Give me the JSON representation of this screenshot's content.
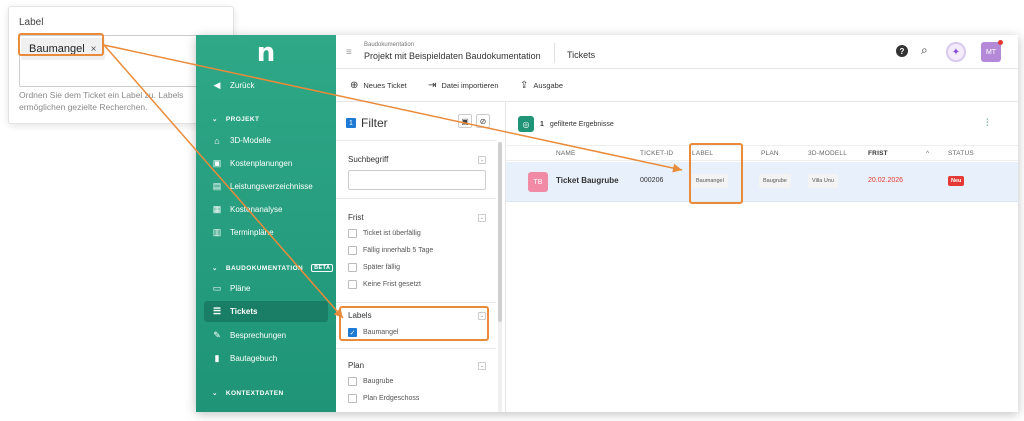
{
  "label_card": {
    "title": "Label",
    "chip_text": "Baumangel",
    "chip_remove": "×",
    "hint": "Ordnen Sie dem Ticket ein Label zu. Labels ermöglichen gezielte Recherchen."
  },
  "sidebar": {
    "logo": "n",
    "back": "Zurück",
    "sections": [
      {
        "label": "PROJEKT"
      },
      {
        "label": "BAUDOKUMENTATION",
        "badge": "BETA"
      },
      {
        "label": "KONTEXTDATEN"
      }
    ],
    "projekt_items": [
      "3D-Modelle",
      "Kostenplanungen",
      "Leistungsverzeichnisse",
      "Kostenanalyse",
      "Terminpläne"
    ],
    "baudoku_items": [
      "Pläne",
      "Tickets",
      "Besprechungen",
      "Bautagebuch"
    ],
    "active_item": "Tickets"
  },
  "topbar": {
    "crumb_small": "Baudokumentation",
    "crumb_main": "Projekt mit Beispieldaten Baudokumentation",
    "page_title": "Tickets",
    "help": "?",
    "avatar": "MT"
  },
  "toolbar": {
    "new_ticket": "Neues Ticket",
    "import": "Datei importieren",
    "export": "Ausgabe"
  },
  "filter": {
    "title": "Filter",
    "search_title": "Suchbegriff",
    "search_value": "",
    "frist_title": "Frist",
    "frist_options": [
      "Ticket ist überfällig",
      "Fällig innerhalb 5 Tage",
      "Später fällig",
      "Keine Frist gesetzt"
    ],
    "labels_title": "Labels",
    "labels_options": [
      {
        "label": "Baumangel",
        "checked": true
      }
    ],
    "plan_title": "Plan",
    "plan_options": [
      "Baugrube",
      "Plan Erdgeschoss"
    ]
  },
  "results": {
    "count": "1",
    "count_suffix": "gefilterte Ergebnisse",
    "columns": [
      "NAME",
      "TICKET-ID",
      "LABEL",
      "PLAN",
      "3D-MODELL",
      "FRIST",
      "STATUS"
    ],
    "sort_indicator": "^",
    "row": {
      "avatar": "TB",
      "name": "Ticket Baugrube",
      "ticket_id": "000206",
      "label": "Baumangel",
      "plan": "Baugrube",
      "model": "Villa Unu",
      "frist": "20.02.2026",
      "status": "Neu"
    }
  },
  "colors": {
    "accent": "#1f9477",
    "highlight": "#e98b3a",
    "status_new": "#e53935"
  }
}
